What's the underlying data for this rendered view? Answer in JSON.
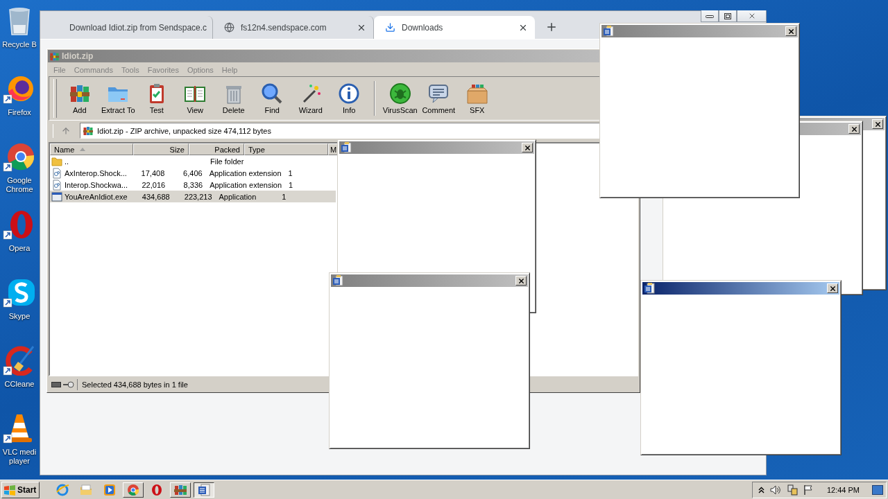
{
  "desktop_icons": [
    {
      "label": "Recycle B"
    },
    {
      "label": "Firefox"
    },
    {
      "label": "Google Chrome"
    },
    {
      "label": "Opera"
    },
    {
      "label": "Skype"
    },
    {
      "label": "CCleane"
    },
    {
      "label": "VLC medi player"
    }
  ],
  "browser": {
    "tabs": [
      {
        "title": "Download Idiot.zip from Sendspace.c",
        "selected": false
      },
      {
        "title": "fs12n4.sendspace.com",
        "selected": false
      },
      {
        "title": "Downloads",
        "selected": true
      }
    ]
  },
  "archive": {
    "title": "Idiot.zip",
    "active": false,
    "menu": [
      "File",
      "Commands",
      "Tools",
      "Favorites",
      "Options",
      "Help"
    ],
    "toolbar_groups": [
      {
        "buttons": [
          "Add",
          "Extract To",
          "Test",
          "View",
          "Delete",
          "Find",
          "Wizard",
          "Info"
        ]
      },
      {
        "buttons": [
          "VirusScan",
          "Comment",
          "SFX"
        ]
      }
    ],
    "address": "Idiot.zip - ZIP archive, unpacked size 474,112 bytes",
    "columns": [
      {
        "label": "Name",
        "sorted": true
      },
      {
        "label": "Size",
        "sorted": false
      },
      {
        "label": "Packed",
        "sorted": false
      },
      {
        "label": "Type",
        "sorted": false
      },
      {
        "label": "M"
      }
    ],
    "rows": [
      {
        "kind": "folder",
        "name": "..",
        "type": "File folder",
        "selected": false
      },
      {
        "kind": "extension",
        "name": "AxInterop.Shock...",
        "size": "17,408",
        "packed": "6,406",
        "type": "Application extension",
        "column_5": "1",
        "selected": false
      },
      {
        "kind": "extension",
        "name": "Interop.Shockwa...",
        "size": "22,016",
        "packed": "8,336",
        "type": "Application extension",
        "column_5": "1",
        "selected": false
      },
      {
        "kind": "application",
        "name": "YouAreAnIdiot.exe",
        "size": "434,688",
        "packed": "223,213",
        "type": "Application",
        "column_5": "1",
        "selected": true
      }
    ],
    "status": "Selected 434,688 bytes in 1 file"
  },
  "popups": [
    {
      "active": false
    },
    {
      "active": false
    },
    {
      "active": false
    },
    {
      "active": false
    },
    {
      "active": false
    },
    {
      "active": true
    }
  ],
  "taskbar": {
    "start": "Start",
    "items": [
      {
        "running": false,
        "selected": false
      },
      {
        "running": false,
        "selected": false
      },
      {
        "running": false,
        "selected": false
      },
      {
        "running": true,
        "selected": false
      },
      {
        "running": false,
        "selected": false
      },
      {
        "running": true,
        "selected": false
      },
      {
        "running": true,
        "selected": true
      }
    ],
    "clock": "12:44 PM"
  }
}
